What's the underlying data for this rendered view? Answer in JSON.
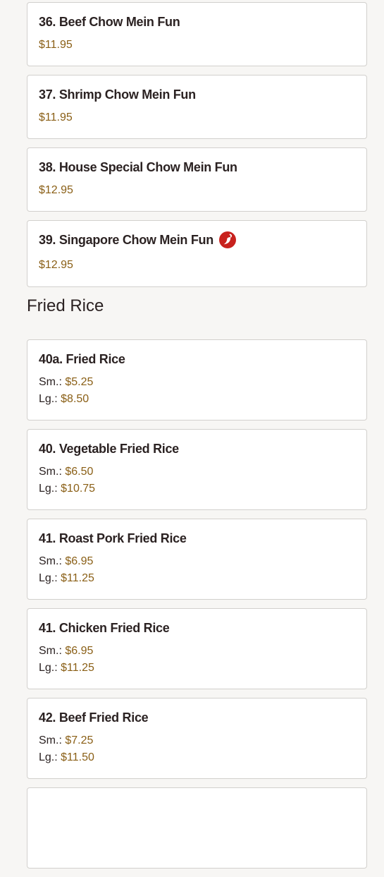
{
  "chow_mein_fun_items": [
    {
      "name": "36. Beef Chow Mein Fun",
      "price": "$11.95"
    },
    {
      "name": "37. Shrimp Chow Mein Fun",
      "price": "$11.95"
    },
    {
      "name": "38. House Special Chow Mein Fun",
      "price": "$12.95"
    },
    {
      "name": "39. Singapore Chow Mein Fun",
      "price": "$12.95",
      "icon": "spicy-icon"
    }
  ],
  "fried_rice": {
    "title": "Fried Rice",
    "items": [
      {
        "name": "40a. Fried Rice",
        "sm_label": "Sm.:",
        "sm_price": "$5.25",
        "lg_label": "Lg.:",
        "lg_price": "$8.50"
      },
      {
        "name": "40. Vegetable Fried Rice",
        "sm_label": "Sm.:",
        "sm_price": "$6.50",
        "lg_label": "Lg.:",
        "lg_price": "$10.75"
      },
      {
        "name": "41. Roast Pork Fried Rice",
        "sm_label": "Sm.:",
        "sm_price": "$6.95",
        "lg_label": "Lg.:",
        "lg_price": "$11.25"
      },
      {
        "name": "41. Chicken Fried Rice",
        "sm_label": "Sm.:",
        "sm_price": "$6.95",
        "lg_label": "Lg.:",
        "lg_price": "$11.25"
      },
      {
        "name": "42. Beef Fried Rice",
        "sm_label": "Sm.:",
        "sm_price": "$7.25",
        "lg_label": "Lg.:",
        "lg_price": "$11.50"
      }
    ]
  },
  "colors": {
    "background": "#f7f6f4",
    "text": "#2b2222",
    "price": "#8a5f16",
    "spicy_icon": "#c8221e",
    "card_border": "#d2d0cd"
  }
}
